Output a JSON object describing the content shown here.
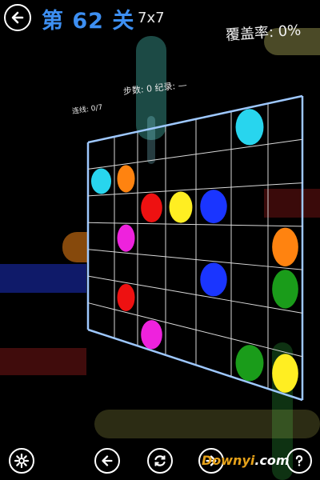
{
  "header": {
    "level_title": "第 62 关",
    "grid_size": "7x7",
    "coverage": "覆盖率: 0%",
    "steps_record": "步数: 0  纪录: —",
    "links": "连线: 0/7"
  },
  "watermark": {
    "part1": "Downyi",
    "part2": ".com"
  },
  "colors": {
    "cyan": "#28d5ee",
    "orange": "#ff8310",
    "red": "#ee1111",
    "yellow": "#ffee22",
    "blue": "#1a35ff",
    "magenta": "#ee22dd",
    "green": "#1a9c1a",
    "grid_border": "#9ec8ff",
    "title_blue": "#3d8ff2"
  },
  "board": {
    "rows": 7,
    "cols": 7,
    "dots": [
      {
        "row": 0,
        "col": 5,
        "color": "cyan"
      },
      {
        "row": 1,
        "col": 0,
        "color": "cyan"
      },
      {
        "row": 1,
        "col": 1,
        "color": "orange"
      },
      {
        "row": 2,
        "col": 2,
        "color": "red"
      },
      {
        "row": 2,
        "col": 3,
        "color": "yellow"
      },
      {
        "row": 2,
        "col": 4,
        "color": "blue"
      },
      {
        "row": 3,
        "col": 1,
        "color": "magenta"
      },
      {
        "row": 3,
        "col": 6,
        "color": "orange"
      },
      {
        "row": 4,
        "col": 4,
        "color": "blue"
      },
      {
        "row": 4,
        "col": 6,
        "color": "green"
      },
      {
        "row": 5,
        "col": 1,
        "color": "red"
      },
      {
        "row": 6,
        "col": 2,
        "color": "magenta"
      },
      {
        "row": 6,
        "col": 5,
        "color": "green"
      },
      {
        "row": 6,
        "col": 6,
        "color": "yellow"
      }
    ]
  },
  "toolbar": {
    "icons": [
      "gear-icon",
      "arrow-left-icon",
      "refresh-icon",
      "arrow-right-icon",
      "question-icon"
    ]
  }
}
